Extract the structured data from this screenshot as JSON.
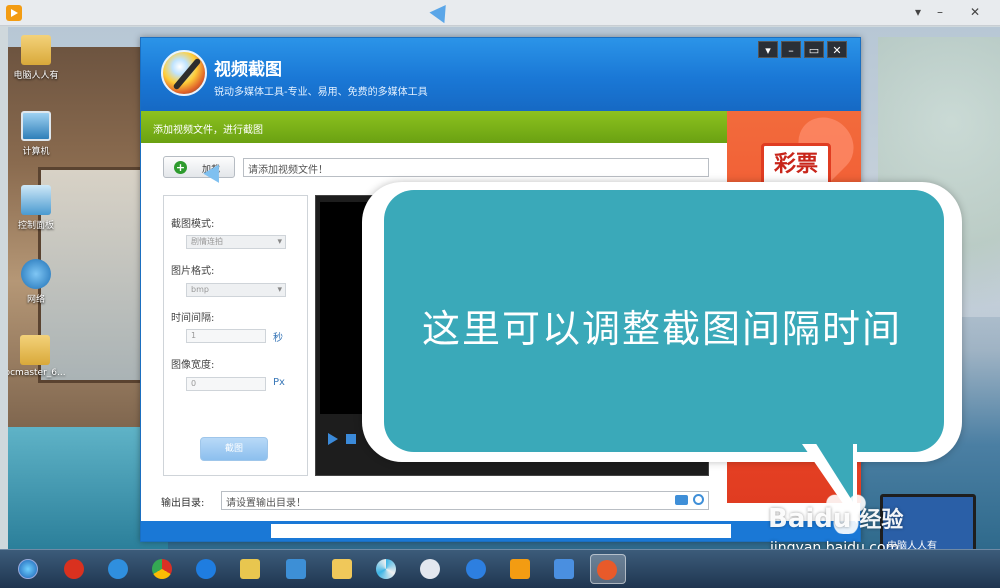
{
  "desktop_icons": [
    {
      "label": "电脑人人有",
      "icon": "folder-icon"
    },
    {
      "label": "计算机",
      "icon": "computer-icon"
    },
    {
      "label": "控制面板",
      "icon": "control-panel-icon"
    },
    {
      "label": "网络",
      "icon": "network-icon"
    },
    {
      "label": "pcmaster_6...",
      "icon": "folder-icon"
    }
  ],
  "app": {
    "title": "视频截图",
    "subtitle": "锐动多媒体工具-专业、易用、免费的多媒体工具",
    "hint": "添加视频文件，进行截图",
    "load_label": "加载",
    "file_placeholder": "请添加视频文件！",
    "settings": {
      "mode_label": "截图模式:",
      "mode_value": "剧情连拍",
      "format_label": "图片格式:",
      "format_value": "bmp",
      "interval_label": "时间间隔:",
      "interval_value": "1",
      "interval_unit": "秒",
      "width_label": "图像宽度:",
      "width_value": "0",
      "width_unit": "Px"
    },
    "capture_label": "截图",
    "output_label": "输出目录:",
    "output_placeholder": "请设置输出目录！"
  },
  "ad": {
    "text": "彩票"
  },
  "overlay": {
    "message": "这里可以调整截图间隔时间"
  },
  "watermark": {
    "brand": "Baidu",
    "brand_cn": "经验",
    "url": "jingyan.baidu.com",
    "laptop_text": "电脑人人有"
  },
  "taskbar_icons": [
    "start-icon",
    "app-icon",
    "ie-icon",
    "chrome-icon",
    "qq-browser-icon",
    "files-icon",
    "network-app-icon",
    "explorer-icon",
    "pinwheel-icon",
    "paint-icon",
    "media-icon",
    "video-player-icon",
    "box-icon",
    "record-icon"
  ],
  "colors": {
    "accent": "#1a78d6",
    "green": "#8dc21f",
    "bubble": "#3aa9b9"
  }
}
